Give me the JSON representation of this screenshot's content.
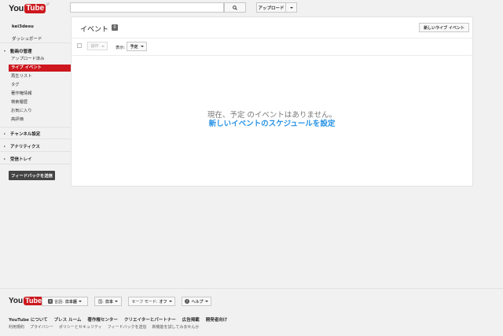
{
  "header": {
    "logo_you": "You",
    "logo_tube": "Tube",
    "logo_region": "JP",
    "search_placeholder": "",
    "upload_label": "アップロード"
  },
  "sidebar": {
    "username": "kei3desu",
    "dashboard": "ダッシュボード",
    "video_manager": "動画の管理",
    "items": [
      {
        "label": "アップロード済み"
      },
      {
        "label": "ライブ イベント"
      },
      {
        "label": "再生リスト"
      },
      {
        "label": "タグ"
      },
      {
        "label": "著作権情報"
      },
      {
        "label": "検索履歴"
      },
      {
        "label": "お気に入り"
      },
      {
        "label": "高評価"
      }
    ],
    "channel_settings": "チャンネル設定",
    "analytics": "アナリティクス",
    "inbox": "受信トレイ",
    "feedback_button": "フィードバックを送信"
  },
  "main": {
    "title": "イベント",
    "count": "0",
    "new_live_event": "新しいライブ イベント",
    "action_label": "操作",
    "show_label": "表示:",
    "filter_value": "予定",
    "empty_message": "現在、予定 のイベントはありません。",
    "schedule_link": "新しいイベントのスケジュールを設定"
  },
  "footer": {
    "logo_you": "You",
    "logo_tube": "Tube",
    "language_prefix": "言語:",
    "language_value": "日本語",
    "country_prefix": "国:",
    "country_value": "日本",
    "safety_label": "セーフ モード:",
    "safety_value": "オフ",
    "help_label": "ヘルプ",
    "links": [
      "YouTube について",
      "プレス ルーム",
      "著作権センター",
      "クリエイターとパートナー",
      "広告掲載",
      "開発者向け"
    ],
    "sublinks": [
      "利用規約",
      "プライバシー",
      "ポリシーとセキュリティ",
      "フィードバックを送信",
      "新機能を試してみませんか"
    ]
  }
}
